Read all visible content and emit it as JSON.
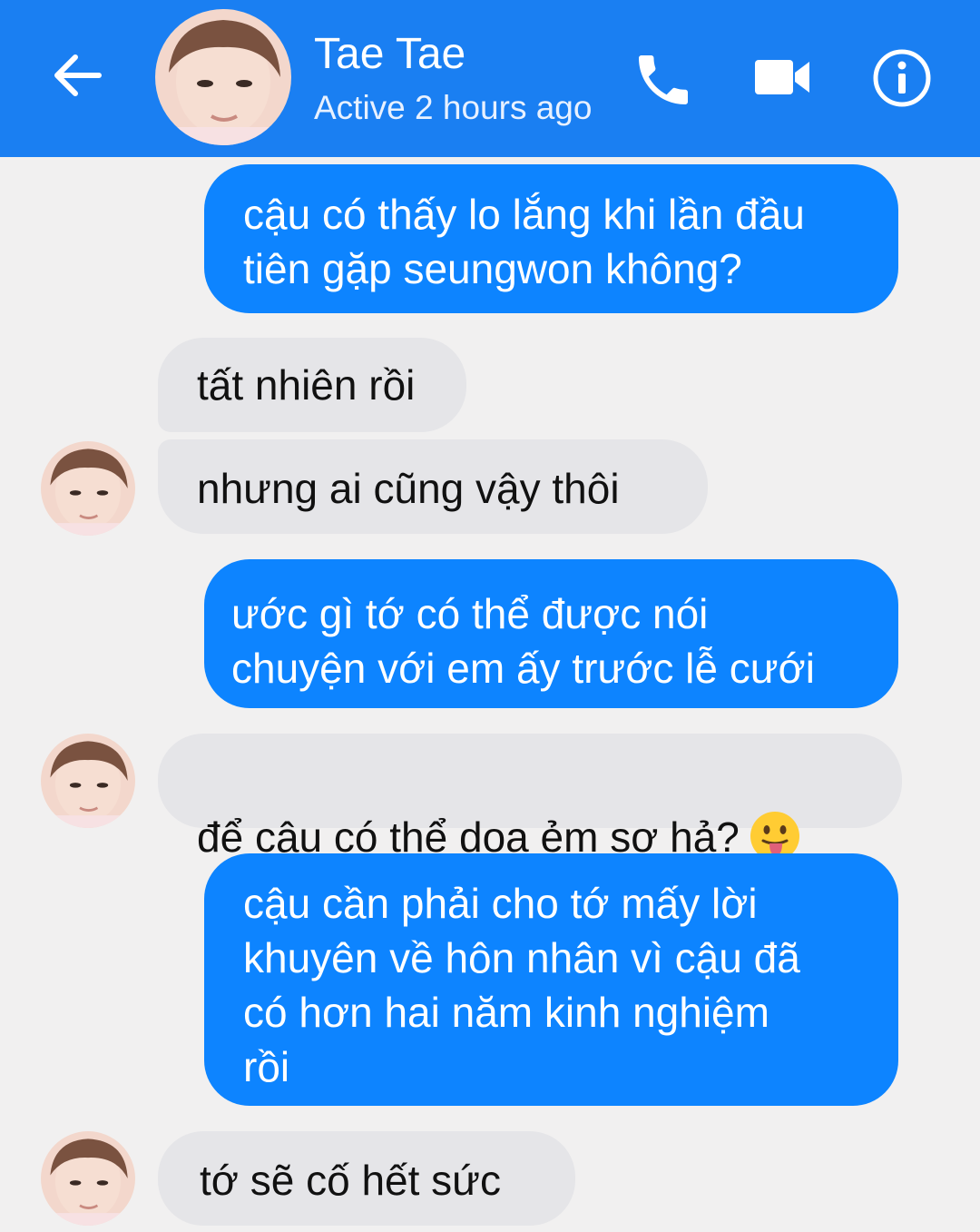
{
  "header": {
    "name": "Tae Tae",
    "status": "Active 2 hours ago"
  },
  "messages": [
    {
      "sender": "me",
      "text": "cậu có thấy lo lắng khi lần đầu\ntiên gặp seungwon không?"
    },
    {
      "sender": "them",
      "text": "tất nhiên rồi"
    },
    {
      "sender": "them",
      "text": "nhưng ai cũng vậy thôi"
    },
    {
      "sender": "me",
      "text": "ước gì tớ có thể được nói\nchuyện với em ấy trước lễ cưới"
    },
    {
      "sender": "them",
      "text": "để cậu có thể dọa ẻm sợ hả?",
      "emoji": "tongue-out-emoji"
    },
    {
      "sender": "me",
      "text": "cậu cần phải cho tớ mấy lời\nkhuyên về hôn nhân vì cậu đã\ncó hơn hai năm kinh nghiệm\nrồi"
    },
    {
      "sender": "them",
      "text": "tớ sẽ cố hết sức"
    }
  ],
  "colors": {
    "header": "#1a7ff2",
    "sent_bubble": "#0d84ff",
    "received_bubble": "#e5e5e8",
    "background": "#f1f0f0"
  }
}
